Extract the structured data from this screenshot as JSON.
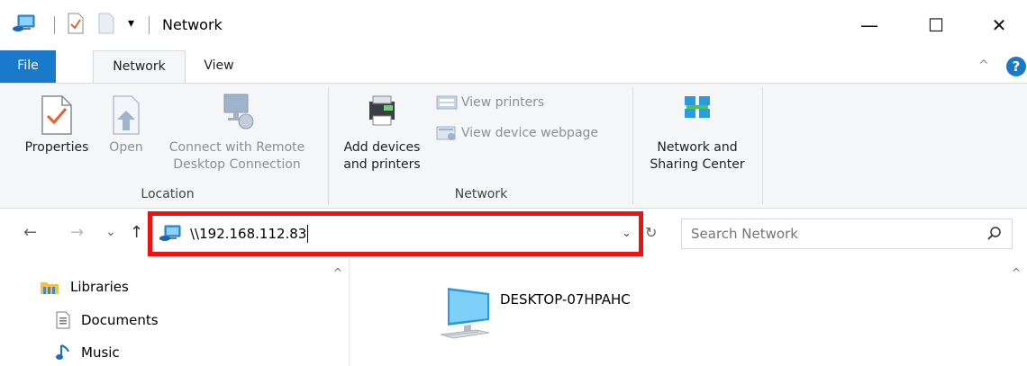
{
  "window": {
    "title": "Network",
    "minimize_glyph": "—",
    "maximize_glyph": "☐",
    "close_glyph": "✕",
    "qa_dropdown_glyph": "▾"
  },
  "ribbon_tabs": {
    "file": "File",
    "network": "Network",
    "view": "View",
    "collapse_glyph": "^",
    "help_glyph": "?"
  },
  "ribbon": {
    "properties": "Properties",
    "open": "Open",
    "connect_line1": "Connect with Remote",
    "connect_line2": "Desktop Connection",
    "location_group": "Location",
    "add_devices_line1": "Add devices",
    "add_devices_line2": "and printers",
    "view_printers": "View printers",
    "view_device_webpage": "View device webpage",
    "network_group": "Network",
    "nsc_line1": "Network and",
    "nsc_line2": "Sharing Center"
  },
  "navigation": {
    "back_glyph": "←",
    "forward_glyph": "→",
    "recent_glyph": "⌄",
    "up_glyph": "↑",
    "address_value": "\\\\192.168.112.83",
    "address_dropdown_glyph": "⌄",
    "refresh_glyph": "↻",
    "search_placeholder": "Search Network"
  },
  "nav_pane": {
    "items": [
      {
        "label": "Libraries"
      },
      {
        "label": "Documents"
      },
      {
        "label": "Music"
      }
    ],
    "scroll_glyph": "^"
  },
  "content": {
    "items": [
      {
        "label": "DESKTOP-07HPAHC"
      }
    ],
    "scroll_glyph": "^"
  },
  "colors": {
    "accent": "#1979ca",
    "highlight_box": "#ee1111"
  }
}
